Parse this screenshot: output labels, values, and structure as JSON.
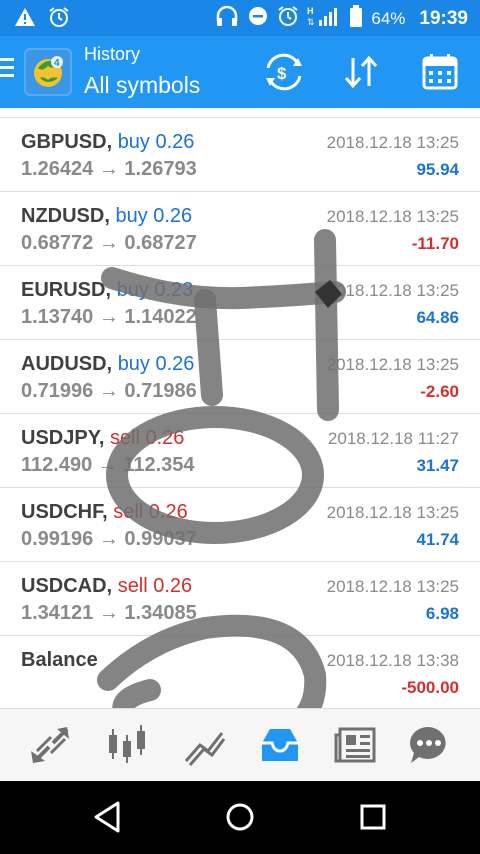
{
  "status_bar": {
    "battery": "64%",
    "time": "19:39"
  },
  "app_bar": {
    "title": "History",
    "subtitle": "All symbols",
    "icons": [
      "menu-icon",
      "mt4-logo",
      "currency-exchange-icon",
      "sort-icon",
      "calendar-icon"
    ]
  },
  "trades": [
    {
      "symbol": "GBPUSD,",
      "direction": "buy 0.26",
      "type": "buy",
      "open_price": "1.26424",
      "arrow": "→",
      "close_price": "1.26793",
      "date": "2018.12.18 13:25",
      "profit": "95.94",
      "sign": "pos"
    },
    {
      "symbol": "NZDUSD,",
      "direction": "buy 0.26",
      "type": "buy",
      "open_price": "0.68772",
      "arrow": "→",
      "close_price": "0.68727",
      "date": "2018.12.18 13:25",
      "profit": "-11.70",
      "sign": "neg"
    },
    {
      "symbol": "EURUSD,",
      "direction": "buy 0.23",
      "type": "buy",
      "open_price": "1.13740",
      "arrow": "→",
      "close_price": "1.14022",
      "date": "2018.12.18 13:25",
      "profit": "64.86",
      "sign": "pos"
    },
    {
      "symbol": "AUDUSD,",
      "direction": "buy 0.26",
      "type": "buy",
      "open_price": "0.71996",
      "arrow": "→",
      "close_price": "0.71986",
      "date": "2018.12.18 13:25",
      "profit": "-2.60",
      "sign": "neg"
    },
    {
      "symbol": "USDJPY,",
      "direction": "sell 0.26",
      "type": "sell",
      "open_price": "112.490",
      "arrow": "→",
      "close_price": "112.354",
      "date": "2018.12.18 11:27",
      "profit": "31.47",
      "sign": "pos"
    },
    {
      "symbol": "USDCHF,",
      "direction": "sell 0.26",
      "type": "sell",
      "open_price": "0.99196",
      "arrow": "→",
      "close_price": "0.99037",
      "date": "2018.12.18 13:25",
      "profit": "41.74",
      "sign": "pos"
    },
    {
      "symbol": "USDCAD,",
      "direction": "sell 0.26",
      "type": "sell",
      "open_price": "1.34121",
      "arrow": "→",
      "close_price": "1.34085",
      "date": "2018.12.18 13:25",
      "profit": "6.98",
      "sign": "pos"
    }
  ],
  "balance": {
    "label": "Balance",
    "date": "2018.12.18 13:38",
    "amount": "-500.00"
  },
  "colors": {
    "status_bar": "#1a87e6",
    "app_bar": "#2196f3",
    "buy": "#1a73d9",
    "sell": "#d32f2f",
    "handwriting": "#6e6e6e"
  },
  "bottom_tabs": [
    "quotes-icon",
    "chart-icon",
    "trade-icon",
    "history-icon",
    "news-icon",
    "chat-icon"
  ],
  "nav_bar": [
    "back-icon",
    "home-icon",
    "recents-icon"
  ]
}
